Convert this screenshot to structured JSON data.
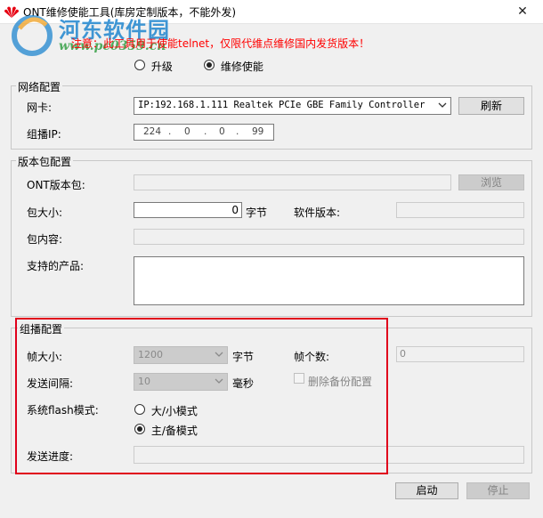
{
  "window": {
    "title": "ONT维修使能工具(库房定制版本，不能外发)",
    "close_glyph": "✕"
  },
  "watermark": {
    "brand": "河东软件园",
    "url": "www.pc0359.cn"
  },
  "notice": "注意：此工具用于使能telnet，仅限代维点维修国内发货版本！",
  "mode": {
    "options": [
      {
        "label": "升级",
        "selected": false
      },
      {
        "label": "维修使能",
        "selected": true
      }
    ]
  },
  "network": {
    "title": "网络配置",
    "nic_label": "网卡:",
    "nic_value": "IP:192.168.1.111 Realtek PCIe GBE Family Controller",
    "refresh_label": "刷新",
    "multicast_ip_label": "组播IP:",
    "ip_octets": [
      "224",
      "0",
      "0",
      "99"
    ]
  },
  "package": {
    "title": "版本包配置",
    "ont_label": "ONT版本包:",
    "browse_label": "浏览",
    "size_label": "包大小:",
    "size_value": "0",
    "size_unit": "字节",
    "sw_version_label": "软件版本:",
    "content_label": "包内容:",
    "products_label": "支持的产品:"
  },
  "multicast": {
    "title": "组播配置",
    "frame_size_label": "帧大小:",
    "frame_size_value": "1200",
    "frame_size_unit": "字节",
    "frame_count_label": "帧个数:",
    "frame_count_value": "0",
    "interval_label": "发送间隔:",
    "interval_value": "10",
    "interval_unit": "毫秒",
    "delete_backup_label": "删除备份配置",
    "flash_mode_label": "系统flash模式:",
    "flash_options": [
      {
        "label": "大/小模式",
        "selected": false
      },
      {
        "label": "主/备模式",
        "selected": true
      }
    ],
    "progress_label": "发送进度:",
    "progress": 0
  },
  "actions": {
    "start_label": "启动",
    "stop_label": "停止"
  },
  "colors": {
    "notice": "#ff0000",
    "highlight": "#e0001b",
    "watermark": "#1f86cf"
  }
}
